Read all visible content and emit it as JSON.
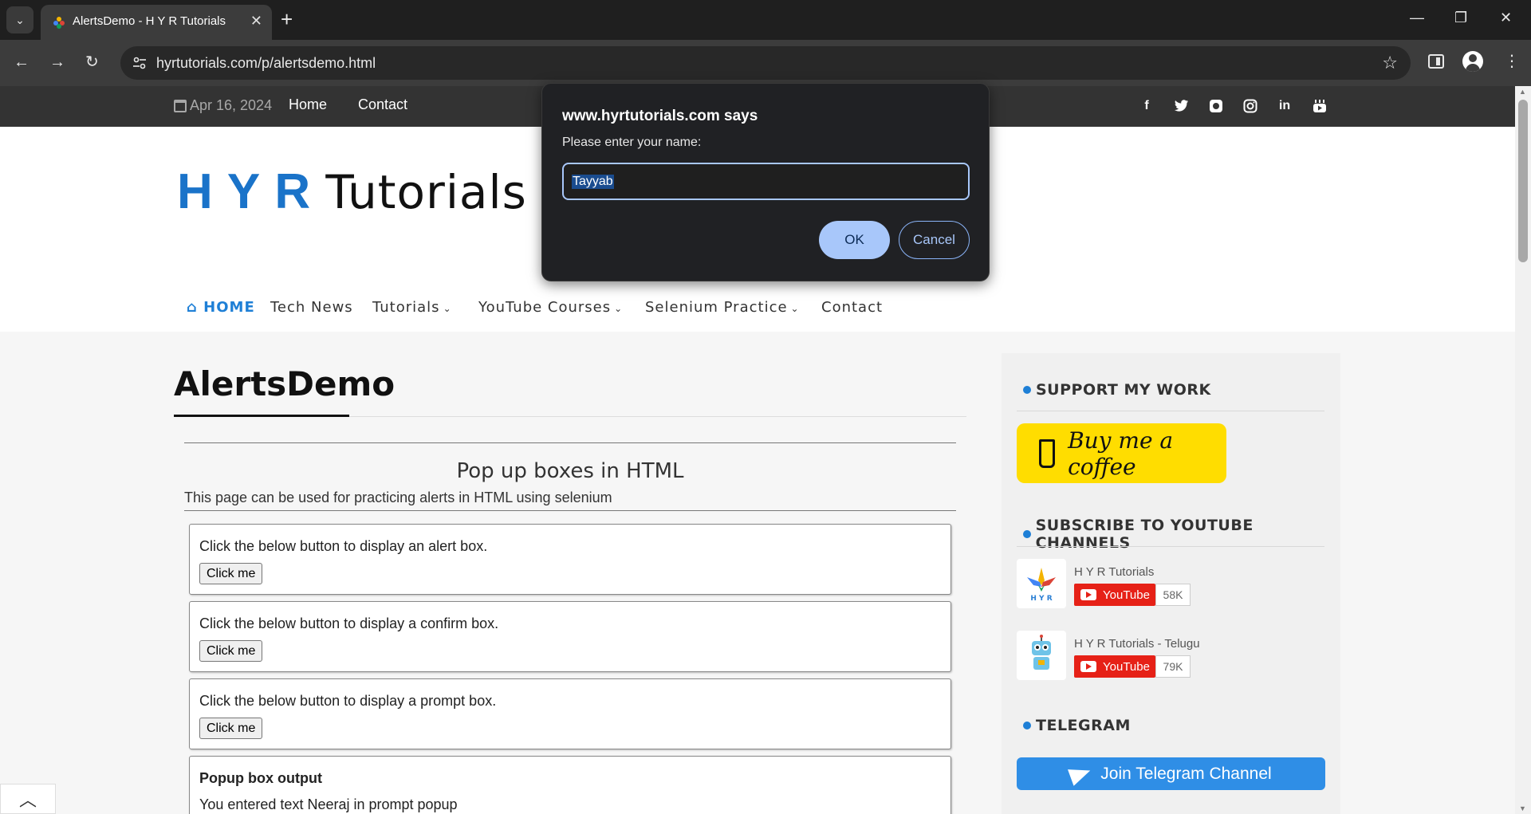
{
  "browser": {
    "tab_title": "AlertsDemo - H Y R Tutorials",
    "url": "hyrtutorials.com/p/alertsdemo.html"
  },
  "topbar": {
    "date": "Apr 16, 2024",
    "links": [
      "Home",
      "Contact"
    ],
    "social_icons": [
      "facebook-icon",
      "twitter-icon",
      "github-icon",
      "instagram-icon",
      "linkedin-icon",
      "youtube-icon"
    ]
  },
  "logo": {
    "part1": "H Y R",
    "part2": "Tutorials"
  },
  "nav": {
    "items": [
      "HOME",
      "Tech News",
      "Tutorials",
      "YouTube Courses",
      "Selenium Practice",
      "Contact"
    ]
  },
  "main": {
    "title": "AlertsDemo",
    "subheading": "Pop up boxes in HTML",
    "intro": "This page can be used for practicing alerts in HTML using selenium",
    "boxes": [
      {
        "text": "Click the below button to display an alert box.",
        "button": "Click me"
      },
      {
        "text": "Click the below button to display a confirm box.",
        "button": "Click me"
      },
      {
        "text": "Click the below button to display a prompt box.",
        "button": "Click me"
      }
    ],
    "output": {
      "title": "Popup box output",
      "text": "You entered text Neeraj in prompt popup"
    }
  },
  "sidebar": {
    "support_heading": "SUPPORT MY WORK",
    "coffee_label": "Buy me a coffee",
    "subscribe_heading": "SUBSCRIBE TO YOUTUBE CHANNELS",
    "channels": [
      {
        "name": "H Y R Tutorials",
        "button": "YouTube",
        "count": "58K"
      },
      {
        "name": "H Y R Tutorials - Telugu",
        "button": "YouTube",
        "count": "79K"
      }
    ],
    "telegram_heading": "TELEGRAM",
    "telegram_button": "Join Telegram Channel"
  },
  "dialog": {
    "title": "www.hyrtutorials.com says",
    "message": "Please enter your name:",
    "input_value": "Tayyab",
    "ok": "OK",
    "cancel": "Cancel"
  },
  "colors": {
    "accent": "#1e7fd6",
    "dialog_button": "#a8c7fa",
    "youtube_red": "#e62117",
    "coffee_yellow": "#ffdd00",
    "telegram_blue": "#2f8ee6"
  }
}
